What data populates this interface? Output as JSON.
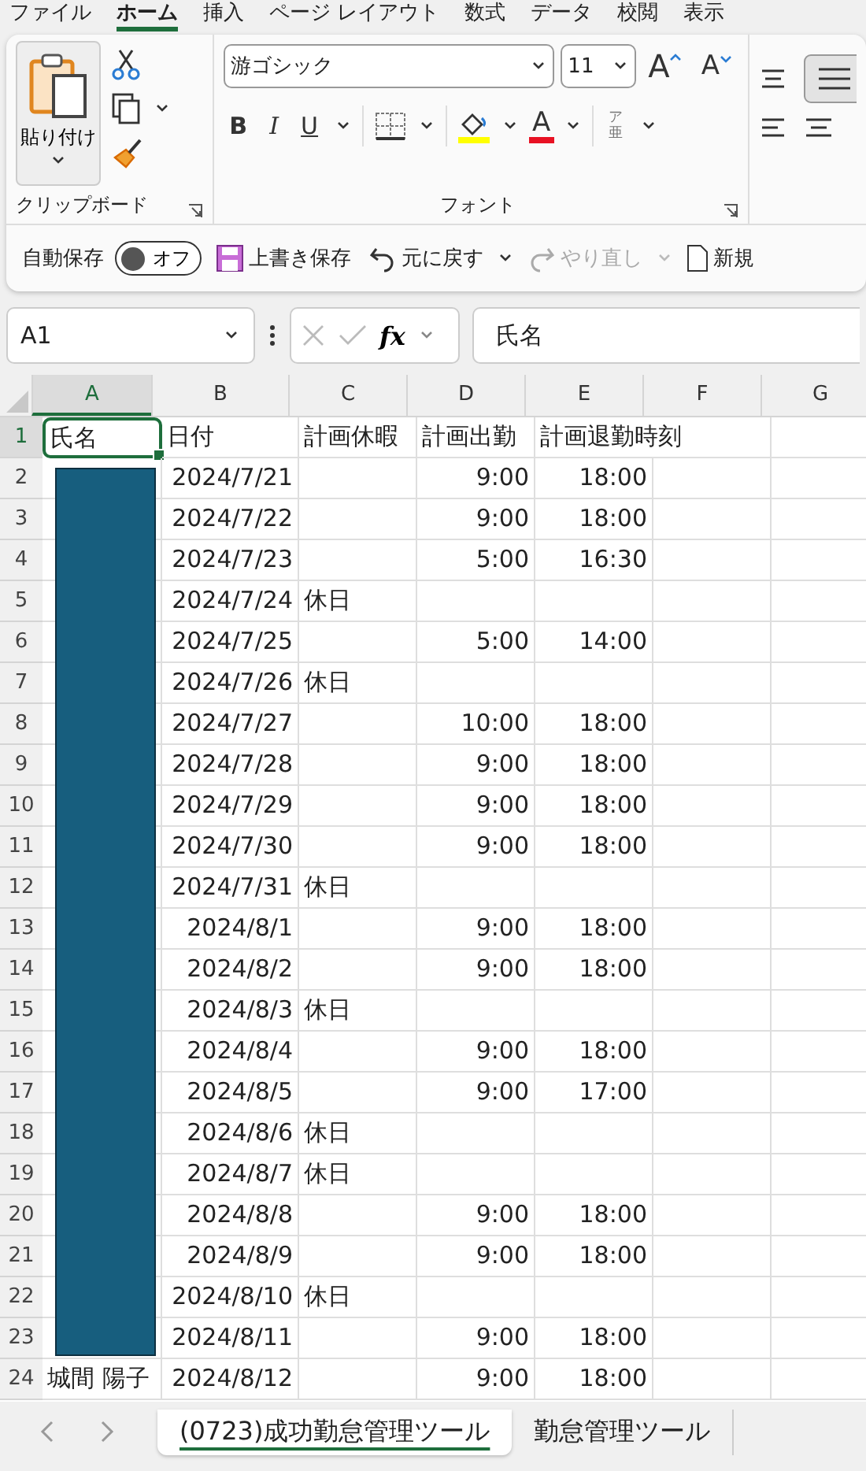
{
  "menu_tabs": [
    {
      "label": "ファイル",
      "selected": false
    },
    {
      "label": "ホーム",
      "selected": true
    },
    {
      "label": "挿入",
      "selected": false
    },
    {
      "label": "ページ レイアウト",
      "selected": false
    },
    {
      "label": "数式",
      "selected": false
    },
    {
      "label": "データ",
      "selected": false
    },
    {
      "label": "校閲",
      "selected": false
    },
    {
      "label": "表示",
      "selected": false
    }
  ],
  "clipboard": {
    "paste_label": "貼り付け",
    "group_label": "クリップボード"
  },
  "font_group": {
    "font_name": "游ゴシック",
    "font_size": "11",
    "grow": "A",
    "shrink": "A",
    "bold": "B",
    "italic": "I",
    "underline": "U",
    "font_color": "A",
    "phonetic_top": "ア",
    "phonetic_bottom": "亜",
    "group_label": "フォント"
  },
  "quick_access": {
    "autosave_label": "自動保存",
    "autosave_on": false,
    "toggle_label": "オフ",
    "save_label": "上書き保存",
    "undo_label": "元に戻す",
    "redo_label": "やり直し",
    "redo_disabled": true,
    "new_label": "新規"
  },
  "formula_bar": {
    "name_box": "A1",
    "fx": "fx",
    "content": "氏名"
  },
  "columns": [
    {
      "label": "A",
      "selected": true
    },
    {
      "label": "B",
      "selected": false
    },
    {
      "label": "C",
      "selected": false
    },
    {
      "label": "D",
      "selected": false
    },
    {
      "label": "E",
      "selected": false
    },
    {
      "label": "F",
      "selected": false
    },
    {
      "label": "G",
      "selected": false
    }
  ],
  "rows": [
    {
      "num": "1",
      "cells": [
        "氏名",
        "日付",
        "計画休暇",
        "計画出勤",
        "計画退勤時刻"
      ],
      "selected": true
    },
    {
      "num": "2",
      "cells": [
        "",
        "2024/7/21",
        "",
        "9:00",
        "18:00"
      ],
      "selected": false
    },
    {
      "num": "3",
      "cells": [
        "",
        "2024/7/22",
        "",
        "9:00",
        "18:00"
      ],
      "selected": false
    },
    {
      "num": "4",
      "cells": [
        "",
        "2024/7/23",
        "",
        "5:00",
        "16:30"
      ],
      "selected": false
    },
    {
      "num": "5",
      "cells": [
        "",
        "2024/7/24",
        "休日",
        "",
        ""
      ],
      "selected": false
    },
    {
      "num": "6",
      "cells": [
        "",
        "2024/7/25",
        "",
        "5:00",
        "14:00"
      ],
      "selected": false
    },
    {
      "num": "7",
      "cells": [
        "",
        "2024/7/26",
        "休日",
        "",
        ""
      ],
      "selected": false
    },
    {
      "num": "8",
      "cells": [
        "",
        "2024/7/27",
        "",
        "10:00",
        "18:00"
      ],
      "selected": false
    },
    {
      "num": "9",
      "cells": [
        "",
        "2024/7/28",
        "",
        "9:00",
        "18:00"
      ],
      "selected": false
    },
    {
      "num": "10",
      "cells": [
        "",
        "2024/7/29",
        "",
        "9:00",
        "18:00"
      ],
      "selected": false
    },
    {
      "num": "11",
      "cells": [
        "",
        "2024/7/30",
        "",
        "9:00",
        "18:00"
      ],
      "selected": false
    },
    {
      "num": "12",
      "cells": [
        "",
        "2024/7/31",
        "休日",
        "",
        ""
      ],
      "selected": false
    },
    {
      "num": "13",
      "cells": [
        "",
        "2024/8/1",
        "",
        "9:00",
        "18:00"
      ],
      "selected": false
    },
    {
      "num": "14",
      "cells": [
        "",
        "2024/8/2",
        "",
        "9:00",
        "18:00"
      ],
      "selected": false
    },
    {
      "num": "15",
      "cells": [
        "",
        "2024/8/3",
        "休日",
        "",
        ""
      ],
      "selected": false
    },
    {
      "num": "16",
      "cells": [
        "",
        "2024/8/4",
        "",
        "9:00",
        "18:00"
      ],
      "selected": false
    },
    {
      "num": "17",
      "cells": [
        "",
        "2024/8/5",
        "",
        "9:00",
        "17:00"
      ],
      "selected": false
    },
    {
      "num": "18",
      "cells": [
        "",
        "2024/8/6",
        "休日",
        "",
        ""
      ],
      "selected": false
    },
    {
      "num": "19",
      "cells": [
        "",
        "2024/8/7",
        "休日",
        "",
        ""
      ],
      "selected": false
    },
    {
      "num": "20",
      "cells": [
        "",
        "2024/8/8",
        "",
        "9:00",
        "18:00"
      ],
      "selected": false
    },
    {
      "num": "21",
      "cells": [
        "",
        "2024/8/9",
        "",
        "9:00",
        "18:00"
      ],
      "selected": false
    },
    {
      "num": "22",
      "cells": [
        "",
        "2024/8/10",
        "休日",
        "",
        ""
      ],
      "selected": false
    },
    {
      "num": "23",
      "cells": [
        "",
        "2024/8/11",
        "",
        "9:00",
        "18:00"
      ],
      "selected": false
    },
    {
      "num": "24",
      "cells": [
        "城間 陽子",
        "2024/8/12",
        "",
        "9:00",
        "18:00"
      ],
      "selected": false
    }
  ],
  "sheet_tabs": [
    {
      "label": "(0723)成功勤怠管理ツール",
      "selected": true
    },
    {
      "label": "勤怠管理ツール",
      "selected": false
    }
  ]
}
